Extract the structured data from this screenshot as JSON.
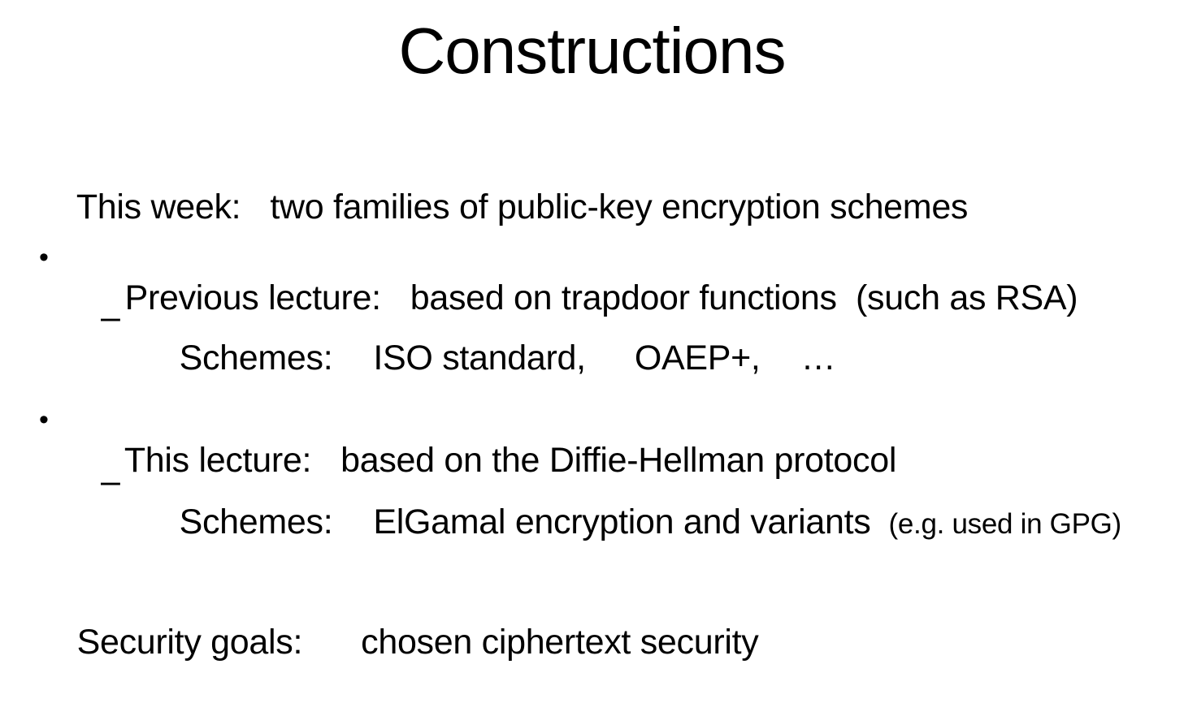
{
  "slide": {
    "title": "Constructions",
    "intro": {
      "label": "This week:",
      "text": "two families of public-key encryption schemes"
    },
    "bullets": [
      {
        "marker": "•",
        "label": "Previous lecture:",
        "text": "based on trapdoor functions  (such as RSA)",
        "sub": {
          "marker": "–",
          "label": "Schemes:",
          "items": [
            "ISO standard,",
            "OAEP+,",
            "…"
          ]
        }
      },
      {
        "marker": "•",
        "label": "This lecture:",
        "text": "based on the Diffie-Hellman protocol",
        "sub": {
          "marker": "–",
          "label": "Schemes:",
          "text": "ElGamal encryption and variants",
          "note": "(e.g. used in GPG)"
        }
      }
    ],
    "footer": {
      "label": "Security goals:",
      "text": "chosen ciphertext security"
    }
  }
}
